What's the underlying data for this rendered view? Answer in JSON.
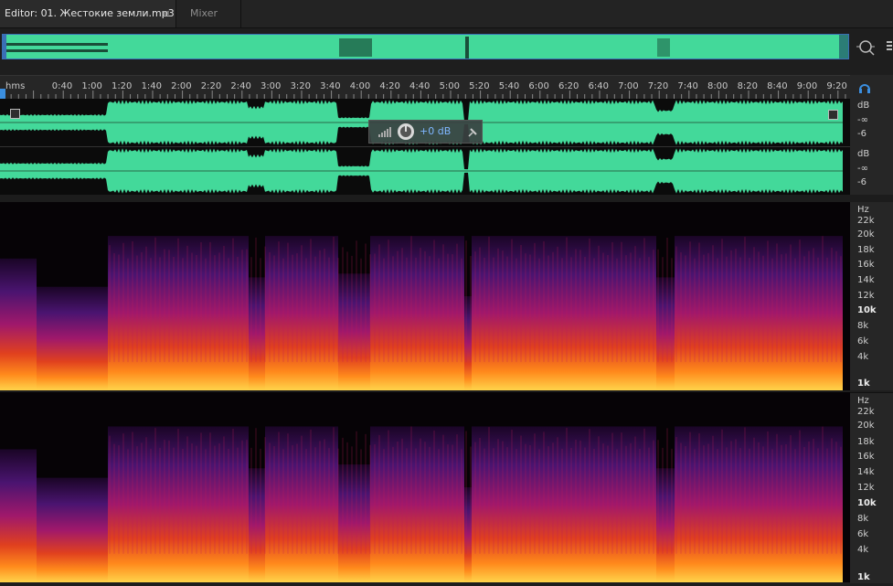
{
  "tabs": {
    "editor_label": "Editor: 01. Жестокие земли.mp3",
    "mixer_label": "Mixer",
    "menu_icon": "hamburger-icon"
  },
  "ruler": {
    "unit_label": "hms",
    "ticks": [
      "0:40",
      "1:00",
      "1:20",
      "1:40",
      "2:00",
      "2:20",
      "2:40",
      "3:00",
      "3:20",
      "3:40",
      "4:00",
      "4:20",
      "4:40",
      "5:00",
      "5:20",
      "5:40",
      "6:00",
      "6:20",
      "6:40",
      "7:00",
      "7:20",
      "7:40",
      "8:00",
      "8:20",
      "8:40",
      "9:00",
      "9:20"
    ]
  },
  "hud": {
    "gain_label": "+0 dB",
    "icons": [
      "level-meter-icon",
      "gain-knob-icon",
      "pin-icon"
    ]
  },
  "amplitude_scale": {
    "channels": [
      {
        "unit": "dB",
        "labels": [
          "-∞",
          "-6"
        ]
      },
      {
        "unit": "dB",
        "labels": [
          "-∞",
          "-6"
        ]
      }
    ]
  },
  "spectral_scale": {
    "unit": "Hz",
    "labels": [
      "22k",
      "20k",
      "18k",
      "16k",
      "14k",
      "12k",
      "10k",
      "8k",
      "6k",
      "4k",
      "1k"
    ]
  },
  "colors": {
    "waveform": "#43d99a",
    "selection_border": "#3a6fb5",
    "playhead": "#3b8fe0",
    "background": "#1e1e1e"
  }
}
